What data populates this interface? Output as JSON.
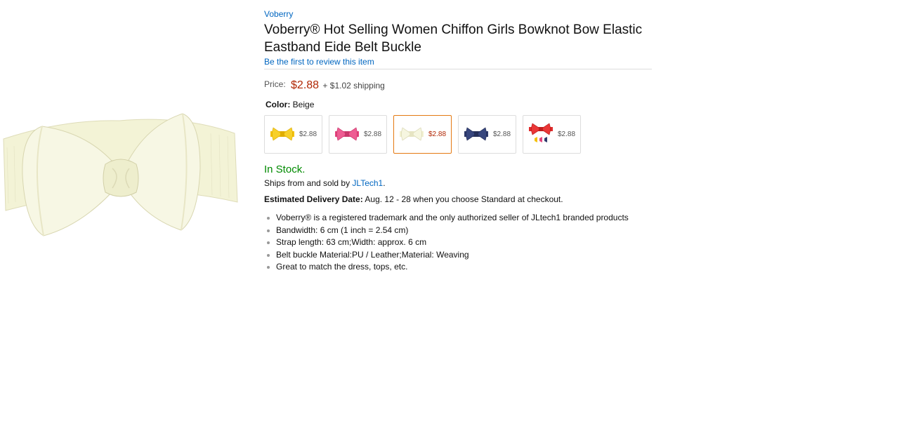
{
  "product": {
    "brand": "Voberry",
    "title": "Voberry® Hot Selling Women Chiffon Girls Bowknot Bow Elastic Eastband Eide Belt Buckle",
    "review_link": "Be the first to review this item",
    "price_label": "Price:",
    "price": "$2.88",
    "shipping": "+ $1.02 shipping",
    "color_label": "Color:",
    "color_value": "Beige",
    "swatches": [
      {
        "color": "yellow",
        "hex": "#f4c20d",
        "price": "$2.88",
        "selected": false
      },
      {
        "color": "pink",
        "hex": "#e4457e",
        "price": "$2.88",
        "selected": false
      },
      {
        "color": "beige",
        "hex": "#f2f1d2",
        "price": "$2.88",
        "selected": true
      },
      {
        "color": "navy",
        "hex": "#2e3a6b",
        "price": "$2.88",
        "selected": false
      },
      {
        "color": "red",
        "hex": "#e02a2a",
        "price": "$2.88",
        "selected": false
      }
    ],
    "stock": "In Stock.",
    "ships_prefix": "Ships from and sold by",
    "seller": "JLTech1",
    "ships_suffix": ".",
    "delivery_label": "Estimated Delivery Date:",
    "delivery_text": "Aug. 12 - 28 when you choose Standard at checkout.",
    "features": [
      "Voberry® is a registered trademark and the only authorized seller of JLtech1 branded products",
      "Bandwidth: 6 cm (1 inch = 2.54 cm)",
      "Strap length: 63 cm;Width: approx. 6 cm",
      "Belt buckle Material:PU / Leather;Material: Weaving",
      "Great to match the dress, tops, etc."
    ]
  },
  "colors": {
    "link": "#0066c0",
    "price": "#b12704",
    "stock": "#008a00",
    "selected_border": "#e47911",
    "belt": "#f3f3d6"
  }
}
